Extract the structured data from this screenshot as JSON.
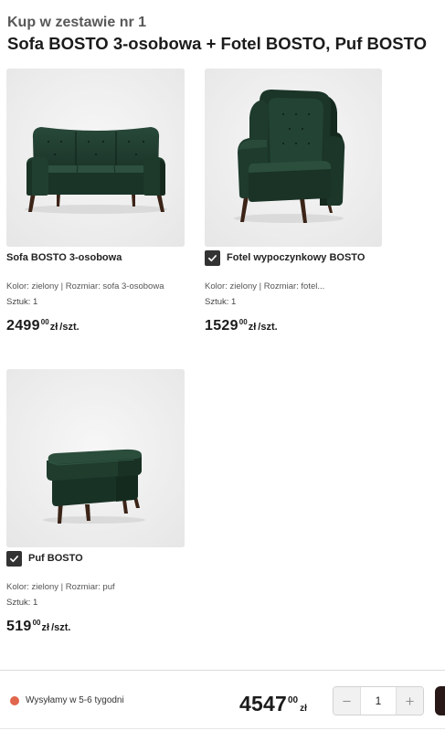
{
  "set": {
    "label": "Kup w zestawie nr 1",
    "title": "Sofa BOSTO 3-osobowa + Fotel BOSTO, Puf BOSTO"
  },
  "products": [
    {
      "name": "Sofa BOSTO 3-osobowa",
      "image": "sofa-image",
      "selectable": false,
      "attributes": "Kolor: zielony | Rozmiar: sofa 3-osobowa",
      "quantity": "Sztuk: 1",
      "price": {
        "amount": "2499",
        "cents": "00",
        "currency": "zł",
        "unit": "/szt."
      }
    },
    {
      "name": "Fotel wypoczynkowy BOSTO",
      "image": "armchair-image",
      "selectable": true,
      "checked": true,
      "attributes": "Kolor: zielony | Rozmiar: fotel...",
      "quantity": "Sztuk: 1",
      "price": {
        "amount": "1529",
        "cents": "00",
        "currency": "zł",
        "unit": "/szt."
      }
    },
    {
      "name": "Puf BOSTO",
      "image": "pouf-image",
      "selectable": true,
      "checked": true,
      "attributes": "Kolor: zielony | Rozmiar: puf",
      "quantity": "Sztuk: 1",
      "price": {
        "amount": "519",
        "cents": "00",
        "currency": "zł",
        "unit": "/szt."
      }
    }
  ],
  "footer": {
    "shipping": {
      "text": "Wysyłamy w 5-6 tygodni",
      "status_icon": "status-dot"
    },
    "total": {
      "amount": "4547",
      "cents": "00",
      "currency": "zł"
    },
    "quantity_stepper": {
      "value": "1",
      "decrease_icon": "minus-icon",
      "increase_icon": "plus-icon"
    }
  },
  "colors": {
    "text_primary": "#1b1b1b",
    "text_secondary": "#555555",
    "checkbox": "#333333",
    "shipping_dot": "#e0664c",
    "upholstery": "#1d3828",
    "legs": "#3b2417",
    "action_button": "#281818"
  }
}
